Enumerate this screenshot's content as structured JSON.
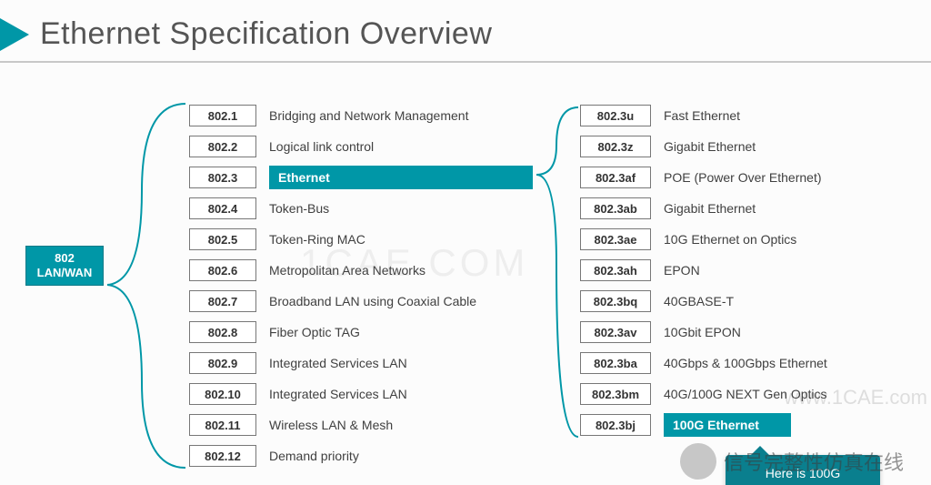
{
  "title": "Ethernet Specification Overview",
  "root": {
    "line1": "802",
    "line2": "LAN/WAN"
  },
  "mid": [
    {
      "code": "802.1",
      "desc": "Bridging and Network Management",
      "hl": false
    },
    {
      "code": "802.2",
      "desc": "Logical link control",
      "hl": false
    },
    {
      "code": "802.3",
      "desc": "Ethernet",
      "hl": true
    },
    {
      "code": "802.4",
      "desc": "Token-Bus",
      "hl": false
    },
    {
      "code": "802.5",
      "desc": "Token-Ring MAC",
      "hl": false
    },
    {
      "code": "802.6",
      "desc": "Metropolitan Area Networks",
      "hl": false
    },
    {
      "code": "802.7",
      "desc": "Broadband LAN using Coaxial Cable",
      "hl": false
    },
    {
      "code": "802.8",
      "desc": "Fiber Optic TAG",
      "hl": false
    },
    {
      "code": "802.9",
      "desc": "Integrated Services LAN",
      "hl": false
    },
    {
      "code": "802.10",
      "desc": "Integrated Services LAN",
      "hl": false
    },
    {
      "code": "802.11",
      "desc": "Wireless LAN & Mesh",
      "hl": false
    },
    {
      "code": "802.12",
      "desc": "Demand priority",
      "hl": false
    }
  ],
  "right": [
    {
      "code": "802.3u",
      "desc": "Fast Ethernet",
      "hl": false
    },
    {
      "code": "802.3z",
      "desc": "Gigabit Ethernet",
      "hl": false
    },
    {
      "code": "802.3af",
      "desc": "POE (Power Over Ethernet)",
      "hl": false
    },
    {
      "code": "802.3ab",
      "desc": "Gigabit Ethernet",
      "hl": false
    },
    {
      "code": "802.3ae",
      "desc": "10G Ethernet on Optics",
      "hl": false
    },
    {
      "code": "802.3ah",
      "desc": "EPON",
      "hl": false
    },
    {
      "code": "802.3bq",
      "desc": "40GBASE-T",
      "hl": false
    },
    {
      "code": "802.3av",
      "desc": "10Gbit EPON",
      "hl": false
    },
    {
      "code": "802.3ba",
      "desc": "40Gbps & 100Gbps Ethernet",
      "hl": false
    },
    {
      "code": "802.3bm",
      "desc": "40G/100G NEXT Gen Optics",
      "hl": false
    },
    {
      "code": "802.3bj",
      "desc": "100G Ethernet",
      "hl": true
    }
  ],
  "callout": "Here is 100G",
  "watermarks": {
    "center": "1CAE.COM",
    "right": "www.1CAE.com",
    "bottom": "信号完整性仿真在线"
  }
}
